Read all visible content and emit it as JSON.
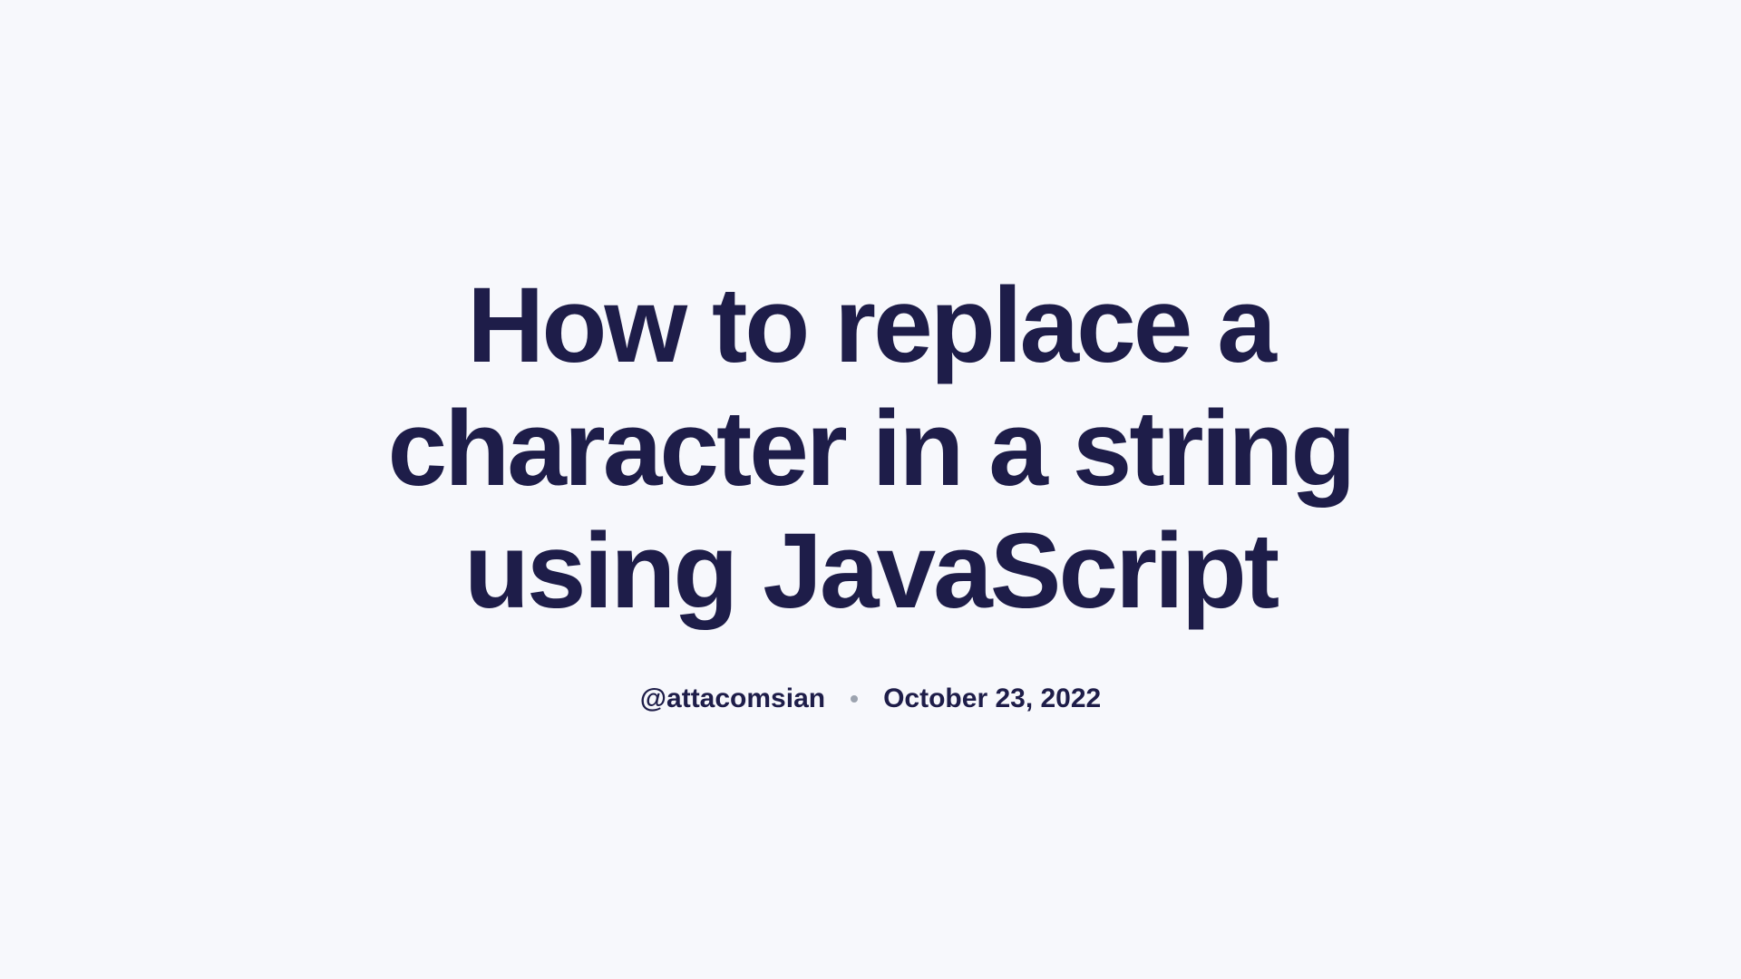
{
  "article": {
    "title": "How to replace a character in a string using JavaScript",
    "author": "@attacomsian",
    "date": "October 23, 2022"
  }
}
